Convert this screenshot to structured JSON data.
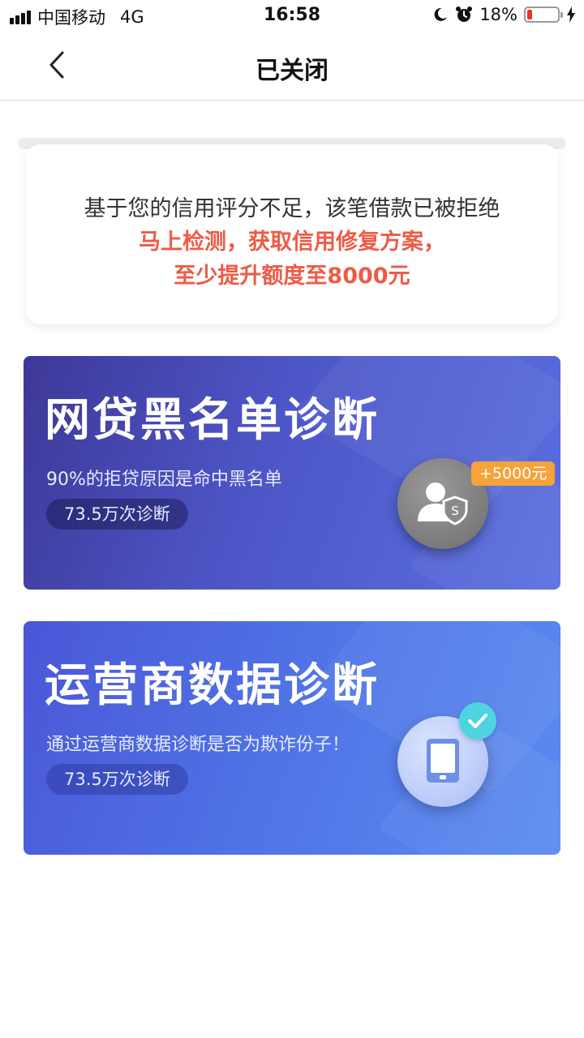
{
  "status_bar": {
    "carrier": "中国移动",
    "network": "4G",
    "time": "16:58",
    "battery_percent": "18%",
    "battery_level": 0.18,
    "icons": [
      "signal-icon",
      "moon-icon",
      "alarm-icon",
      "battery-icon",
      "charging-icon"
    ]
  },
  "nav": {
    "title": "已关闭",
    "back_icon": "chevron-left-icon"
  },
  "message": {
    "line1": "基于您的信用评分不足，该笔借款已被拒绝",
    "line2": "马上检测，获取信用修复方案，",
    "line3": "至少提升额度至8000元",
    "highlight_color": "#ee5b46"
  },
  "cards": [
    {
      "title": "网贷黑名单诊断",
      "subtitle": "90%的拒贷原因是命中黑名单",
      "count": "73.5万次诊断",
      "badge": "+5000元",
      "icon": "user-shield-icon"
    },
    {
      "title": "运营商数据诊断",
      "subtitle": "通过运营商数据诊断是否为欺诈份子！",
      "count": "73.5万次诊断",
      "icon": "phone-icon",
      "badge_icon": "check-icon"
    }
  ]
}
